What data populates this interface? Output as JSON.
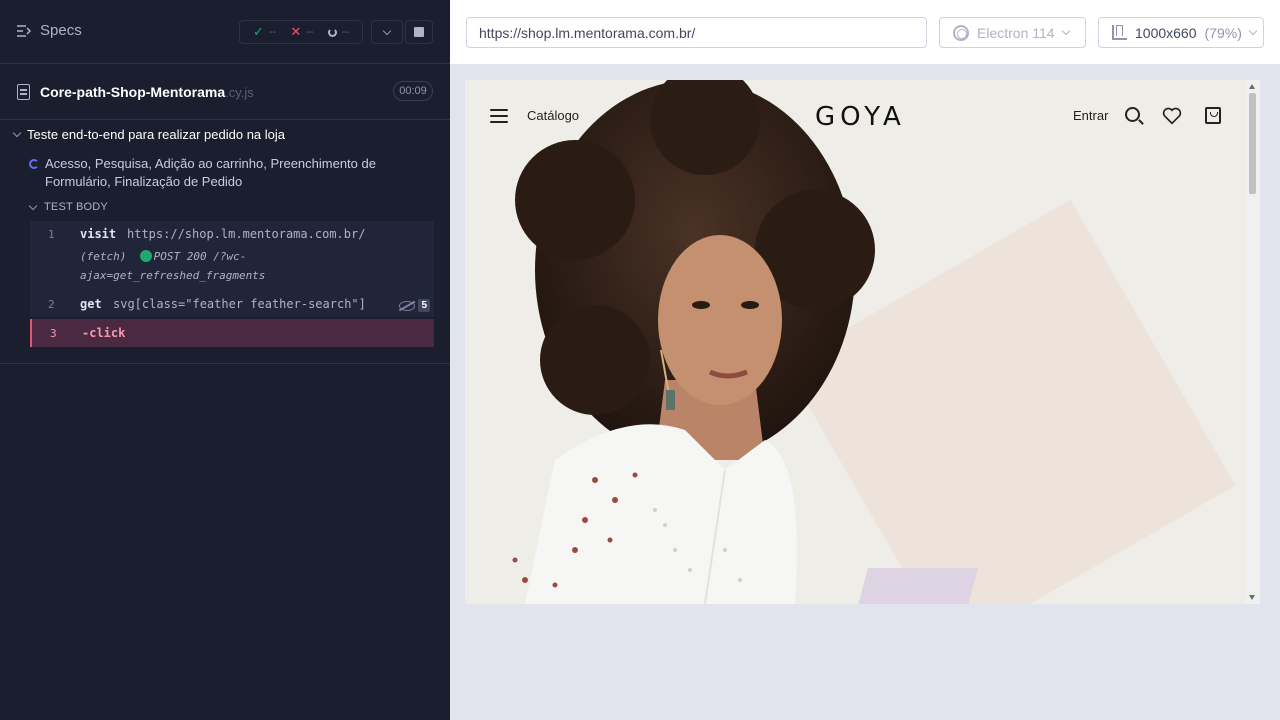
{
  "runner": {
    "specs_label": "Specs",
    "stats": {
      "passed": "--",
      "failed": "--",
      "pending": "--"
    },
    "spec": {
      "name": "Core-path-Shop-Mentorama",
      "ext": ".cy.js",
      "duration": "00:09"
    },
    "suite_title": "Teste end-to-end para realizar pedido na loja",
    "test_title": "Acesso, Pesquisa, Adição ao carrinho, Preenchimento de Formulário, Finalização de Pedido",
    "section_label": "TEST BODY",
    "commands": [
      {
        "num": "1",
        "name": "visit",
        "arg": "https://shop.lm.mentorama.com.br/"
      },
      {
        "fetch_label": "(fetch)",
        "fetch_text": "POST 200 /?wc-",
        "fetch_text2": "ajax=get_refreshed_fragments"
      },
      {
        "num": "2",
        "name": "get",
        "arg": "svg[class=\"feather feather-search\"]",
        "count": "5"
      },
      {
        "num": "3",
        "name": "-click"
      }
    ]
  },
  "browser_bar": {
    "url": "https://shop.lm.mentorama.com.br/",
    "browser": "Electron 114",
    "viewport": "1000x660",
    "zoom": "(79%)"
  },
  "site": {
    "menu_label": "Catálogo",
    "logo": "GOYA",
    "login_label": "Entrar"
  },
  "colors": {
    "accent_pass": "#1fa971",
    "accent_fail": "#e45770",
    "panel_bg": "#1b1e2e"
  }
}
